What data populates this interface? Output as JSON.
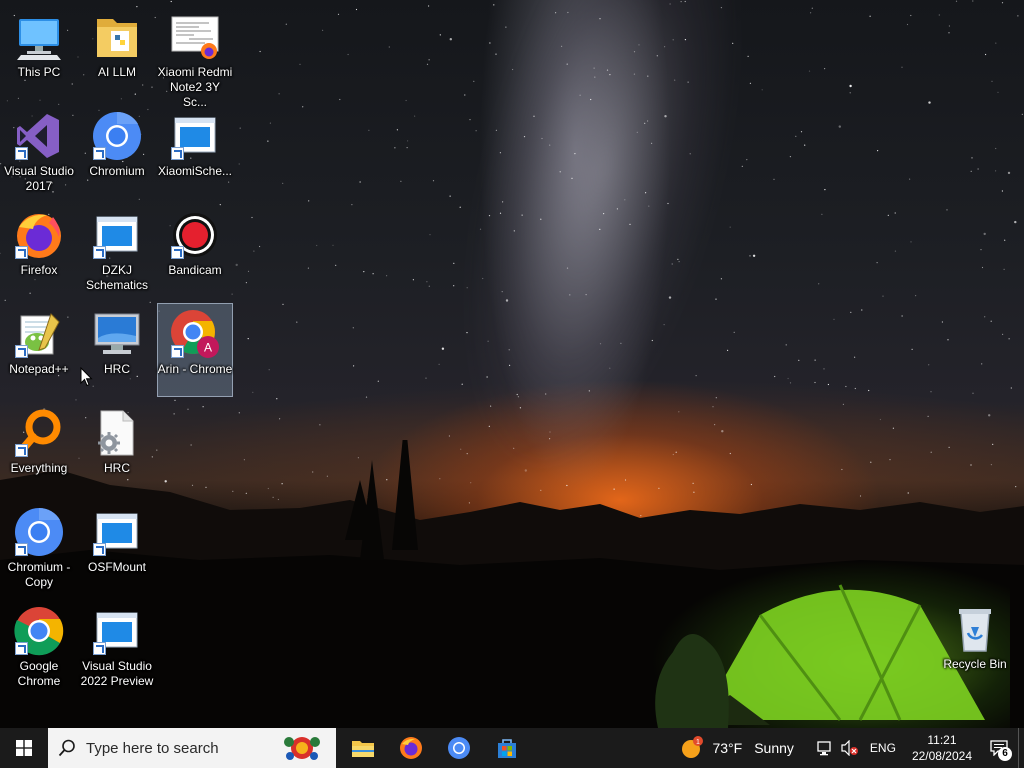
{
  "desktop_icons": [
    {
      "id": "this-pc",
      "label": "This PC",
      "icon": "this-pc-icon",
      "col": 0,
      "row": 0,
      "shortcut": false
    },
    {
      "id": "ai-llm",
      "label": "AI LLM",
      "icon": "folder-icon",
      "col": 1,
      "row": 0,
      "shortcut": false
    },
    {
      "id": "xiaomi-redmi",
      "label": "Xiaomi Redmi Note2 3Y Sc...",
      "icon": "pdf-document-icon",
      "col": 2,
      "row": 0,
      "shortcut": false
    },
    {
      "id": "visual-studio-2017",
      "label": "Visual Studio 2017",
      "icon": "visual-studio-icon",
      "col": 0,
      "row": 1,
      "shortcut": true
    },
    {
      "id": "chromium",
      "label": "Chromium",
      "icon": "chromium-icon",
      "col": 1,
      "row": 1,
      "shortcut": true
    },
    {
      "id": "xiaomi-sche",
      "label": "XiaomiSche...",
      "icon": "app-window-icon",
      "col": 2,
      "row": 1,
      "shortcut": true
    },
    {
      "id": "firefox",
      "label": "Firefox",
      "icon": "firefox-icon",
      "col": 0,
      "row": 2,
      "shortcut": true
    },
    {
      "id": "dzkj-schematics",
      "label": "DZKJ Schematics",
      "icon": "app-window-icon",
      "col": 1,
      "row": 2,
      "shortcut": true
    },
    {
      "id": "bandicam",
      "label": "Bandicam",
      "icon": "bandicam-icon",
      "col": 2,
      "row": 2,
      "shortcut": true
    },
    {
      "id": "notepad-pp",
      "label": "Notepad++",
      "icon": "notepad-plus-plus-icon",
      "col": 0,
      "row": 3,
      "shortcut": true
    },
    {
      "id": "hrc-monitor",
      "label": "HRC",
      "icon": "monitor-icon",
      "col": 1,
      "row": 3,
      "shortcut": false
    },
    {
      "id": "arin-chrome",
      "label": "Arin - Chrome",
      "icon": "chrome-profile-icon",
      "col": 2,
      "row": 3,
      "shortcut": true,
      "selected": true,
      "profile_letter": "A"
    },
    {
      "id": "everything",
      "label": "Everything",
      "icon": "everything-search-icon",
      "col": 0,
      "row": 4,
      "shortcut": true
    },
    {
      "id": "hrc-settings",
      "label": "HRC",
      "icon": "settings-file-icon",
      "col": 1,
      "row": 4,
      "shortcut": false
    },
    {
      "id": "chromium-copy",
      "label": "Chromium - Copy",
      "icon": "chromium-icon",
      "col": 0,
      "row": 5,
      "shortcut": true
    },
    {
      "id": "osfmount",
      "label": "OSFMount",
      "icon": "app-window-icon",
      "col": 1,
      "row": 5,
      "shortcut": true
    },
    {
      "id": "google-chrome",
      "label": "Google Chrome",
      "icon": "chrome-icon",
      "col": 0,
      "row": 6,
      "shortcut": true
    },
    {
      "id": "vs-2022-preview",
      "label": "Visual Studio 2022 Preview",
      "icon": "app-window-icon",
      "col": 1,
      "row": 6,
      "shortcut": true
    }
  ],
  "recycle_bin": {
    "label": "Recycle Bin",
    "icon": "recycle-bin-icon"
  },
  "taskbar": {
    "search_placeholder": "Type here to search",
    "pinned_apps": [
      {
        "name": "file-explorer",
        "icon": "file-explorer-icon"
      },
      {
        "name": "firefox",
        "icon": "firefox-icon"
      },
      {
        "name": "chromium",
        "icon": "chromium-icon"
      },
      {
        "name": "microsoft-store",
        "icon": "store-icon"
      }
    ],
    "weather": {
      "temp": "73°F",
      "condition": "Sunny",
      "alert_count": "1"
    },
    "language": "ENG",
    "time": "11:21",
    "date": "22/08/2024",
    "notification_count": "6"
  },
  "colors": {
    "taskbar": "#1b1b1b",
    "search_bg": "#f3f3f3",
    "accent": "#1f8ae6"
  }
}
